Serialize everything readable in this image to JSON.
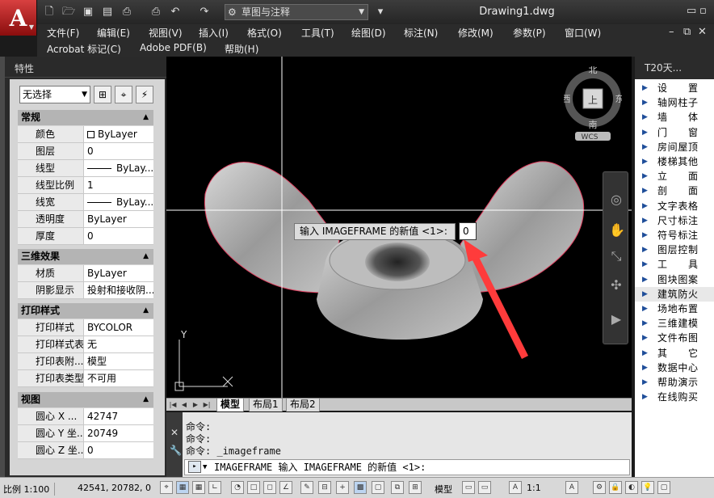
{
  "titlebar": {
    "workspace": "草图与注释",
    "document_title": "Drawing1.dwg"
  },
  "menu": {
    "row1": [
      "文件(F)",
      "编辑(E)",
      "视图(V)",
      "插入(I)",
      "格式(O)",
      "工具(T)",
      "绘图(D)",
      "标注(N)",
      "修改(M)",
      "参数(P)",
      "窗口(W)"
    ],
    "row2": [
      "Acrobat 标记(C)",
      "Adobe PDF(B)",
      "帮助(H)"
    ]
  },
  "palette": {
    "title": "特性",
    "selection": "无选择",
    "sections": [
      {
        "title": "常规",
        "rows": [
          {
            "key": "颜色",
            "value": "ByLayer"
          },
          {
            "key": "图层",
            "value": "0"
          },
          {
            "key": "线型",
            "value": "ByLay..."
          },
          {
            "key": "线型比例",
            "value": "1"
          },
          {
            "key": "线宽",
            "value": "ByLay..."
          },
          {
            "key": "透明度",
            "value": "ByLayer"
          },
          {
            "key": "厚度",
            "value": "0"
          }
        ]
      },
      {
        "title": "三维效果",
        "rows": [
          {
            "key": "材质",
            "value": "ByLayer"
          },
          {
            "key": "阴影显示",
            "value": "投射和接收阴..."
          }
        ]
      },
      {
        "title": "打印样式",
        "rows": [
          {
            "key": "打印样式",
            "value": "BYCOLOR"
          },
          {
            "key": "打印样式表",
            "value": "无"
          },
          {
            "key": "打印表附...",
            "value": "模型"
          },
          {
            "key": "打印表类型",
            "value": "不可用"
          }
        ]
      },
      {
        "title": "视图",
        "rows": [
          {
            "key": "圆心 X ...",
            "value": "42747"
          },
          {
            "key": "圆心 Y 坐...",
            "value": "20749"
          },
          {
            "key": "圆心 Z 坐...",
            "value": "0"
          }
        ]
      }
    ]
  },
  "viewcube": {
    "north": "北",
    "south": "南",
    "east": "东",
    "west": "西",
    "top": "上",
    "wcs": "WCS"
  },
  "viewport": {
    "prompt_label": "输入 IMAGEFRAME 的新值 <1>:",
    "prompt_value": "0",
    "ucs_y": "Y"
  },
  "layout_tabs": [
    "模型",
    "布局1",
    "布局2"
  ],
  "command": {
    "history": [
      "命令:",
      "命令:",
      "命令: _imageframe"
    ],
    "current": "IMAGEFRAME 输入 IMAGEFRAME 的新值 <1>:"
  },
  "t20": {
    "title": "T20天...",
    "items": [
      "设置",
      "轴网柱子",
      "墙体",
      "门窗",
      "房间屋顶",
      "楼梯其他",
      "立面",
      "剖面",
      "文字表格",
      "尺寸标注",
      "符号标注",
      "图层控制",
      "工具",
      "图块图案",
      "建筑防火",
      "场地布置",
      "三维建模",
      "文件布图",
      "其它",
      "数据中心",
      "帮助演示",
      "在线购买"
    ]
  },
  "status": {
    "scale": "比例 1:100",
    "coords": "42541, 20782, 0",
    "model": "模型",
    "annotation_scale": "1:1"
  },
  "colors": {
    "accent": "#c62828",
    "arrow": "#ff3b3b",
    "viewport_bg": "#000000"
  }
}
